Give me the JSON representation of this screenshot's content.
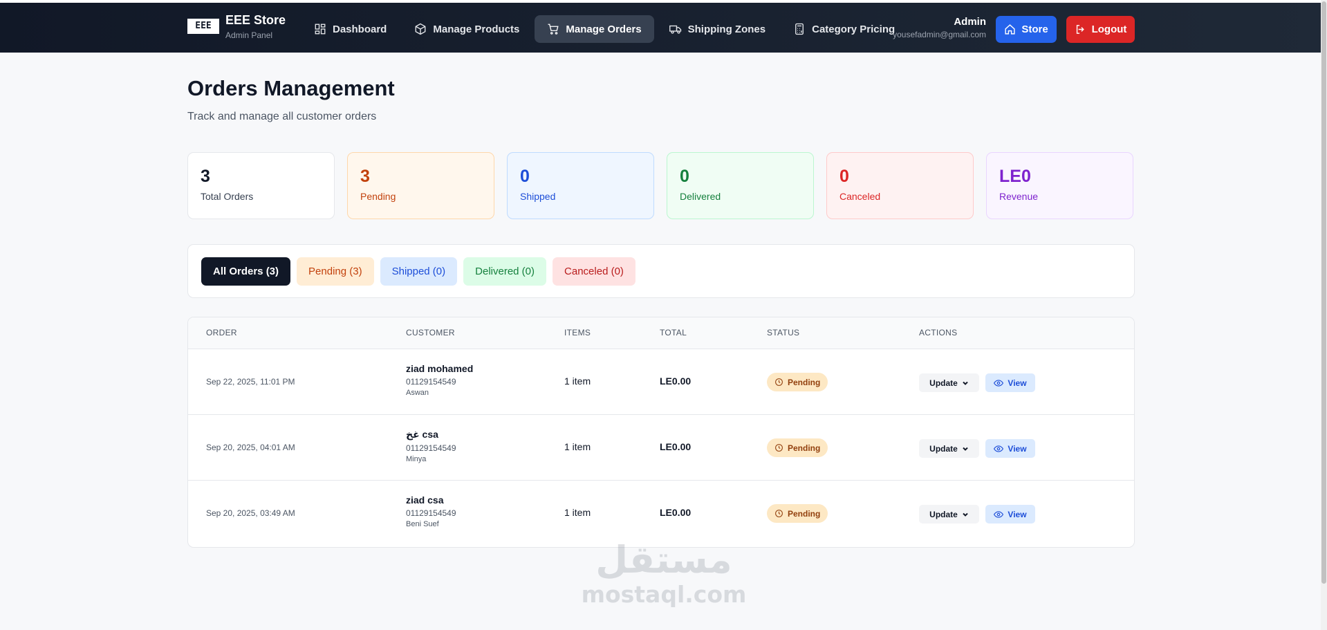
{
  "brand": {
    "logo_text": "EEE",
    "title": "EEE Store",
    "subtitle": "Admin Panel"
  },
  "nav": [
    {
      "label": "Dashboard",
      "icon": "dashboard-icon",
      "active": false
    },
    {
      "label": "Manage Products",
      "icon": "box-icon",
      "active": false
    },
    {
      "label": "Manage Orders",
      "icon": "cart-icon",
      "active": true
    },
    {
      "label": "Shipping Zones",
      "icon": "truck-icon",
      "active": false
    },
    {
      "label": "Category Pricing",
      "icon": "calculator-icon",
      "active": false
    }
  ],
  "user": {
    "name": "Admin",
    "email": "yousefadmin@gmail.com"
  },
  "actions": {
    "store_label": "Store",
    "logout_label": "Logout"
  },
  "page": {
    "title": "Orders Management",
    "subtitle": "Track and manage all customer orders"
  },
  "stats": [
    {
      "value": "3",
      "label": "Total Orders"
    },
    {
      "value": "3",
      "label": "Pending"
    },
    {
      "value": "0",
      "label": "Shipped"
    },
    {
      "value": "0",
      "label": "Delivered"
    },
    {
      "value": "0",
      "label": "Canceled"
    },
    {
      "value": "LE0",
      "label": "Revenue"
    }
  ],
  "filters": [
    {
      "label": "All Orders (3)",
      "active": true
    },
    {
      "label": "Pending (3)",
      "active": false
    },
    {
      "label": "Shipped (0)",
      "active": false
    },
    {
      "label": "Delivered (0)",
      "active": false
    },
    {
      "label": "Canceled (0)",
      "active": false
    }
  ],
  "table": {
    "headers": [
      "Order",
      "Customer",
      "Items",
      "Total",
      "Status",
      "Actions"
    ],
    "rows": [
      {
        "date": "Sep 22, 2025, 11:01 PM",
        "name": "ziad mohamed",
        "phone": "01129154549",
        "city": "Aswan",
        "items": "1 item",
        "total": "LE0.00",
        "status": "Pending"
      },
      {
        "date": "Sep 20, 2025, 04:01 AM",
        "name": "غخ csa",
        "phone": "01129154549",
        "city": "Minya",
        "items": "1 item",
        "total": "LE0.00",
        "status": "Pending"
      },
      {
        "date": "Sep 20, 2025, 03:49 AM",
        "name": "ziad csa",
        "phone": "01129154549",
        "city": "Beni Suef",
        "items": "1 item",
        "total": "LE0.00",
        "status": "Pending"
      }
    ],
    "update_label": "Update",
    "view_label": "View"
  },
  "watermark": {
    "arabic": "مستقل",
    "latin": "mostaql.com"
  },
  "colors": {
    "primary": "#2563eb",
    "danger": "#dc2626",
    "header_bg": "#111827",
    "pending": "#c2410c"
  }
}
